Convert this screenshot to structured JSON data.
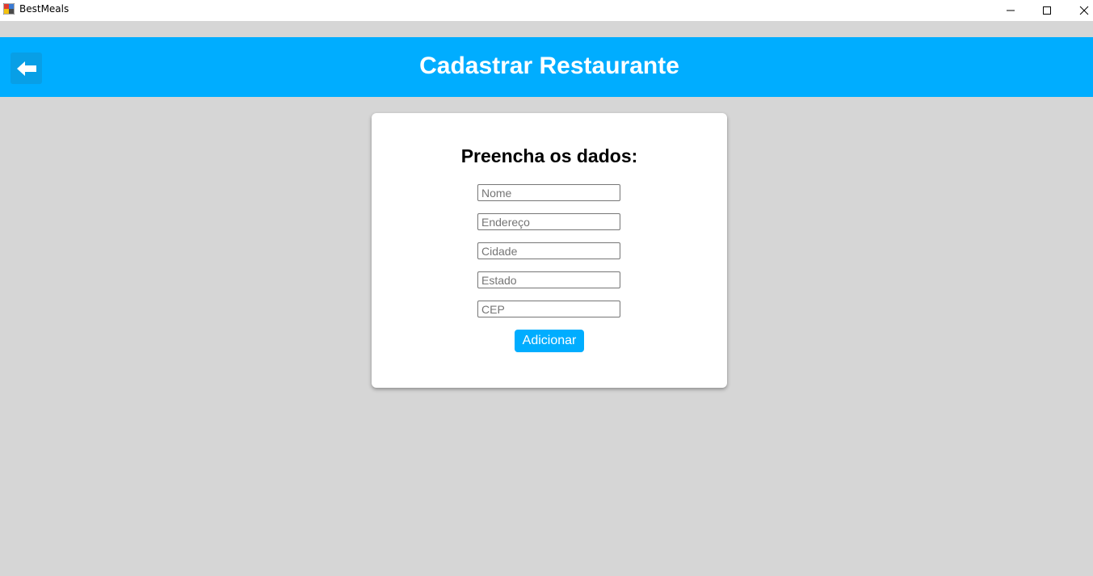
{
  "window": {
    "title": "BestMeals",
    "icon": "app-icon",
    "controls": [
      "minimize-icon",
      "maximize-icon",
      "close-icon"
    ]
  },
  "header": {
    "title": "Cadastrar Restaurante",
    "back_icon": "arrow-left-icon",
    "color": "#00adff"
  },
  "form": {
    "heading": "Preencha os dados:",
    "fields": [
      {
        "name": "nome",
        "placeholder": "Nome",
        "value": ""
      },
      {
        "name": "endereco",
        "placeholder": "Endereço",
        "value": ""
      },
      {
        "name": "cidade",
        "placeholder": "Cidade",
        "value": ""
      },
      {
        "name": "estado",
        "placeholder": "Estado",
        "value": ""
      },
      {
        "name": "cep",
        "placeholder": "CEP",
        "value": ""
      }
    ],
    "submit_label": "Adicionar"
  },
  "colors": {
    "background": "#d6d6d6",
    "accent": "#00adff",
    "card": "#ffffff"
  }
}
